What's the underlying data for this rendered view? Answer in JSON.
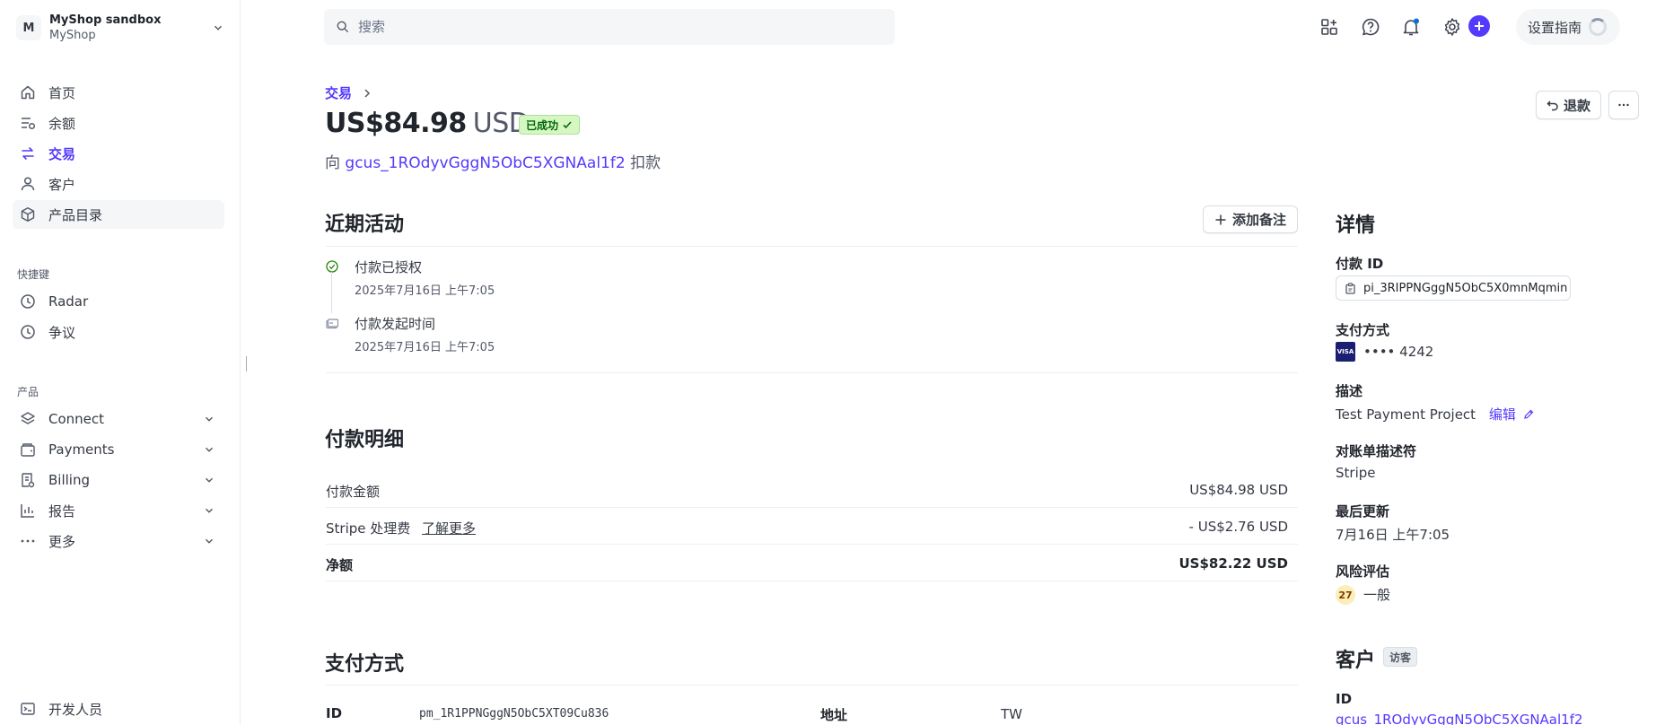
{
  "account": {
    "avatar_letter": "M",
    "name": "MyShop sandbox",
    "sub": "MyShop"
  },
  "nav": {
    "main": [
      {
        "label": "首页",
        "icon": "home-icon"
      },
      {
        "label": "余额",
        "icon": "balance-icon"
      },
      {
        "label": "交易",
        "icon": "transactions-icon",
        "active": true
      },
      {
        "label": "客户",
        "icon": "customer-icon"
      },
      {
        "label": "产品目录",
        "icon": "product-icon",
        "selected": true
      }
    ],
    "shortcuts_title": "快捷键",
    "shortcuts": [
      {
        "label": "Radar",
        "icon": "clock-icon"
      },
      {
        "label": "争议",
        "icon": "clock-icon"
      }
    ],
    "products_title": "产品",
    "products": [
      {
        "label": "Connect",
        "icon": "connect-icon"
      },
      {
        "label": "Payments",
        "icon": "payments-icon"
      },
      {
        "label": "Billing",
        "icon": "billing-icon"
      },
      {
        "label": "报告",
        "icon": "reports-icon"
      },
      {
        "label": "更多",
        "icon": "more-icon"
      }
    ],
    "developers": "开发人员"
  },
  "topbar": {
    "search_placeholder": "搜索",
    "guide": "设置指南"
  },
  "header": {
    "breadcrumb": "交易",
    "amount": "US$84.98",
    "currency": "USD",
    "status": "已成功",
    "charge_prefix": "向",
    "customer_id": "gcus_1ROdyvGggN5ObC5XGNAal1f2",
    "charge_suffix": "扣款",
    "refund": "退款"
  },
  "activity": {
    "title": "近期活动",
    "add_note": "添加备注",
    "events": [
      {
        "title": "付款已授权",
        "time": "2025年7月16日 上午7:05"
      },
      {
        "title": "付款发起时间",
        "time": "2025年7月16日 上午7:05"
      }
    ]
  },
  "breakdown": {
    "title": "付款明细",
    "payment_amount_label": "付款金额",
    "payment_amount": "US$84.98 USD",
    "fee_label": "Stripe 处理费",
    "learn_more": "了解更多",
    "fee": "- US$2.76 USD",
    "net_label": "净额",
    "net": "US$82.22 USD"
  },
  "payment_method": {
    "title": "支付方式",
    "id_label": "ID",
    "id_value": "pm_1R1PPNGggN5ObC5XT09Cu836",
    "address_label": "地址",
    "address_value": "TW"
  },
  "details": {
    "title": "详情",
    "payment_id_label": "付款 ID",
    "payment_id": "pi_3RIPPNGggN5ObC5X0mnMqmin",
    "method_label": "支付方式",
    "card_brand": "VISA",
    "card_last4": "•••• 4242",
    "description_label": "描述",
    "description": "Test Payment Project",
    "edit": "编辑",
    "statement_label": "对账单描述符",
    "statement": "Stripe",
    "updated_label": "最后更新",
    "updated": "7月16日 上午7:05",
    "risk_label": "风险评估",
    "risk_score": "27",
    "risk_level": "一般",
    "customer_title": "客户",
    "guest": "访客",
    "customer_id_label": "ID",
    "customer_id": "gcus_1ROdyvGggN5ObC5XGNAal1f2"
  },
  "colors": {
    "accent": "#533afd",
    "success_bg": "#d7f7c2",
    "success_text": "#006908"
  }
}
